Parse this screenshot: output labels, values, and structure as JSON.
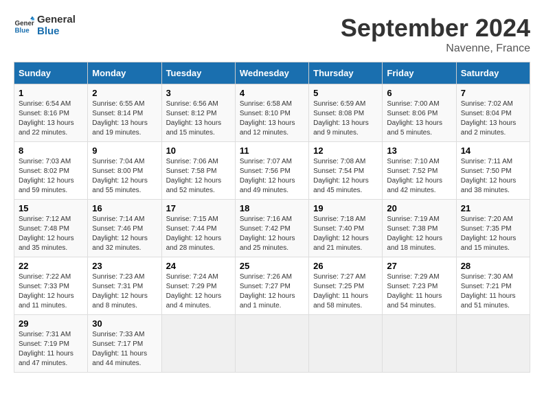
{
  "header": {
    "logo_general": "General",
    "logo_blue": "Blue",
    "month_title": "September 2024",
    "location": "Navenne, France"
  },
  "days_of_week": [
    "Sunday",
    "Monday",
    "Tuesday",
    "Wednesday",
    "Thursday",
    "Friday",
    "Saturday"
  ],
  "weeks": [
    [
      {
        "day": "1",
        "sunrise": "6:54 AM",
        "sunset": "8:16 PM",
        "daylight": "13 hours and 22 minutes."
      },
      {
        "day": "2",
        "sunrise": "6:55 AM",
        "sunset": "8:14 PM",
        "daylight": "13 hours and 19 minutes."
      },
      {
        "day": "3",
        "sunrise": "6:56 AM",
        "sunset": "8:12 PM",
        "daylight": "13 hours and 15 minutes."
      },
      {
        "day": "4",
        "sunrise": "6:58 AM",
        "sunset": "8:10 PM",
        "daylight": "13 hours and 12 minutes."
      },
      {
        "day": "5",
        "sunrise": "6:59 AM",
        "sunset": "8:08 PM",
        "daylight": "13 hours and 9 minutes."
      },
      {
        "day": "6",
        "sunrise": "7:00 AM",
        "sunset": "8:06 PM",
        "daylight": "13 hours and 5 minutes."
      },
      {
        "day": "7",
        "sunrise": "7:02 AM",
        "sunset": "8:04 PM",
        "daylight": "13 hours and 2 minutes."
      }
    ],
    [
      {
        "day": "8",
        "sunrise": "7:03 AM",
        "sunset": "8:02 PM",
        "daylight": "12 hours and 59 minutes."
      },
      {
        "day": "9",
        "sunrise": "7:04 AM",
        "sunset": "8:00 PM",
        "daylight": "12 hours and 55 minutes."
      },
      {
        "day": "10",
        "sunrise": "7:06 AM",
        "sunset": "7:58 PM",
        "daylight": "12 hours and 52 minutes."
      },
      {
        "day": "11",
        "sunrise": "7:07 AM",
        "sunset": "7:56 PM",
        "daylight": "12 hours and 49 minutes."
      },
      {
        "day": "12",
        "sunrise": "7:08 AM",
        "sunset": "7:54 PM",
        "daylight": "12 hours and 45 minutes."
      },
      {
        "day": "13",
        "sunrise": "7:10 AM",
        "sunset": "7:52 PM",
        "daylight": "12 hours and 42 minutes."
      },
      {
        "day": "14",
        "sunrise": "7:11 AM",
        "sunset": "7:50 PM",
        "daylight": "12 hours and 38 minutes."
      }
    ],
    [
      {
        "day": "15",
        "sunrise": "7:12 AM",
        "sunset": "7:48 PM",
        "daylight": "12 hours and 35 minutes."
      },
      {
        "day": "16",
        "sunrise": "7:14 AM",
        "sunset": "7:46 PM",
        "daylight": "12 hours and 32 minutes."
      },
      {
        "day": "17",
        "sunrise": "7:15 AM",
        "sunset": "7:44 PM",
        "daylight": "12 hours and 28 minutes."
      },
      {
        "day": "18",
        "sunrise": "7:16 AM",
        "sunset": "7:42 PM",
        "daylight": "12 hours and 25 minutes."
      },
      {
        "day": "19",
        "sunrise": "7:18 AM",
        "sunset": "7:40 PM",
        "daylight": "12 hours and 21 minutes."
      },
      {
        "day": "20",
        "sunrise": "7:19 AM",
        "sunset": "7:38 PM",
        "daylight": "12 hours and 18 minutes."
      },
      {
        "day": "21",
        "sunrise": "7:20 AM",
        "sunset": "7:35 PM",
        "daylight": "12 hours and 15 minutes."
      }
    ],
    [
      {
        "day": "22",
        "sunrise": "7:22 AM",
        "sunset": "7:33 PM",
        "daylight": "12 hours and 11 minutes."
      },
      {
        "day": "23",
        "sunrise": "7:23 AM",
        "sunset": "7:31 PM",
        "daylight": "12 hours and 8 minutes."
      },
      {
        "day": "24",
        "sunrise": "7:24 AM",
        "sunset": "7:29 PM",
        "daylight": "12 hours and 4 minutes."
      },
      {
        "day": "25",
        "sunrise": "7:26 AM",
        "sunset": "7:27 PM",
        "daylight": "12 hours and 1 minute."
      },
      {
        "day": "26",
        "sunrise": "7:27 AM",
        "sunset": "7:25 PM",
        "daylight": "11 hours and 58 minutes."
      },
      {
        "day": "27",
        "sunrise": "7:29 AM",
        "sunset": "7:23 PM",
        "daylight": "11 hours and 54 minutes."
      },
      {
        "day": "28",
        "sunrise": "7:30 AM",
        "sunset": "7:21 PM",
        "daylight": "11 hours and 51 minutes."
      }
    ],
    [
      {
        "day": "29",
        "sunrise": "7:31 AM",
        "sunset": "7:19 PM",
        "daylight": "11 hours and 47 minutes."
      },
      {
        "day": "30",
        "sunrise": "7:33 AM",
        "sunset": "7:17 PM",
        "daylight": "11 hours and 44 minutes."
      },
      null,
      null,
      null,
      null,
      null
    ]
  ]
}
